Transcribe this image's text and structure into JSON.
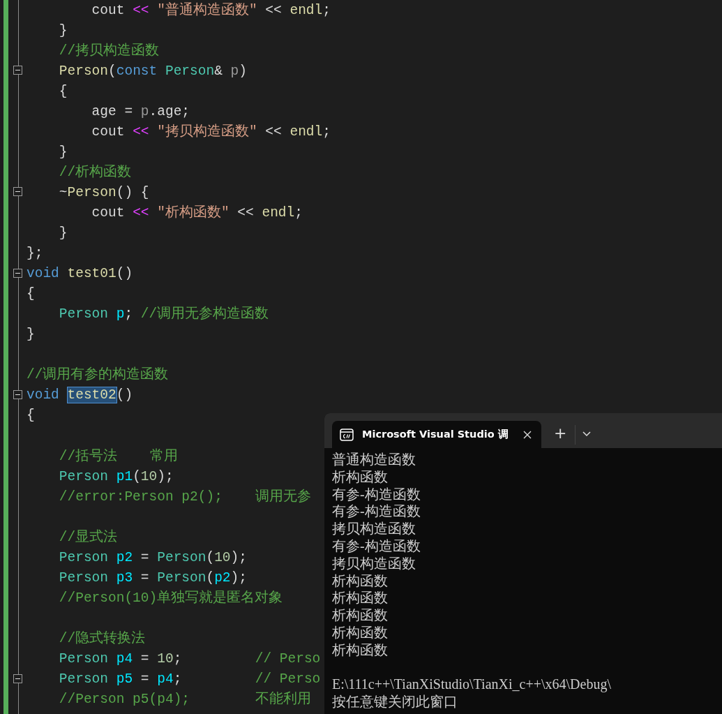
{
  "editor": {
    "lines": [
      {
        "fold": false,
        "segments": [
          {
            "text": "        cout ",
            "kind": "text"
          },
          {
            "text": "<<",
            "kind": "op"
          },
          {
            "text": " \"普通构造函数\"",
            "kind": "string"
          },
          {
            "text": " << ",
            "kind": "text"
          },
          {
            "text": "endl",
            "kind": "func"
          },
          {
            "text": ";",
            "kind": "text"
          }
        ]
      },
      {
        "fold": false,
        "segments": [
          {
            "text": "    }",
            "kind": "text"
          }
        ]
      },
      {
        "fold": false,
        "segments": [
          {
            "text": "    //拷贝构造函数",
            "kind": "comment"
          }
        ]
      },
      {
        "fold": true,
        "segments": [
          {
            "text": "    Person",
            "kind": "func"
          },
          {
            "text": "(",
            "kind": "text"
          },
          {
            "text": "const",
            "kind": "keyword"
          },
          {
            "text": " Person",
            "kind": "type"
          },
          {
            "text": "& ",
            "kind": "text"
          },
          {
            "text": "p",
            "kind": "param"
          },
          {
            "text": ")",
            "kind": "text"
          }
        ]
      },
      {
        "fold": false,
        "segments": [
          {
            "text": "    {",
            "kind": "text"
          }
        ]
      },
      {
        "fold": false,
        "segments": [
          {
            "text": "        age = ",
            "kind": "text"
          },
          {
            "text": "p",
            "kind": "param"
          },
          {
            "text": ".age;",
            "kind": "text"
          }
        ]
      },
      {
        "fold": false,
        "segments": [
          {
            "text": "        cout ",
            "kind": "text"
          },
          {
            "text": "<<",
            "kind": "op"
          },
          {
            "text": " \"拷贝构造函数\"",
            "kind": "string"
          },
          {
            "text": " << ",
            "kind": "text"
          },
          {
            "text": "endl",
            "kind": "func"
          },
          {
            "text": ";",
            "kind": "text"
          }
        ]
      },
      {
        "fold": false,
        "segments": [
          {
            "text": "    }",
            "kind": "text"
          }
        ]
      },
      {
        "fold": false,
        "segments": [
          {
            "text": "    //析构函数",
            "kind": "comment"
          }
        ]
      },
      {
        "fold": true,
        "segments": [
          {
            "text": "    ~",
            "kind": "text"
          },
          {
            "text": "Person",
            "kind": "func"
          },
          {
            "text": "() {",
            "kind": "text"
          }
        ]
      },
      {
        "fold": false,
        "segments": [
          {
            "text": "        cout ",
            "kind": "text"
          },
          {
            "text": "<<",
            "kind": "op"
          },
          {
            "text": " \"析构函数\"",
            "kind": "string"
          },
          {
            "text": " << ",
            "kind": "text"
          },
          {
            "text": "endl",
            "kind": "func"
          },
          {
            "text": ";",
            "kind": "text"
          }
        ]
      },
      {
        "fold": false,
        "segments": [
          {
            "text": "    }",
            "kind": "text"
          }
        ]
      },
      {
        "fold": false,
        "segments": [
          {
            "text": "};",
            "kind": "text"
          }
        ]
      },
      {
        "fold": true,
        "segments": [
          {
            "text": "void ",
            "kind": "keyword"
          },
          {
            "text": "test01",
            "kind": "func"
          },
          {
            "text": "()",
            "kind": "text"
          }
        ]
      },
      {
        "fold": false,
        "segments": [
          {
            "text": "{",
            "kind": "text"
          }
        ]
      },
      {
        "fold": false,
        "segments": [
          {
            "text": "    Person ",
            "kind": "type"
          },
          {
            "text": "p",
            "kind": "var"
          },
          {
            "text": "; ",
            "kind": "text"
          },
          {
            "text": "//调用无参构造函数",
            "kind": "comment"
          }
        ]
      },
      {
        "fold": false,
        "segments": [
          {
            "text": "}",
            "kind": "text"
          }
        ]
      },
      {
        "fold": false
      },
      {
        "fold": false,
        "segments": [
          {
            "text": "//调用有参的构造函数",
            "kind": "comment"
          }
        ]
      },
      {
        "fold": true,
        "segments": [
          {
            "text": "void ",
            "kind": "keyword"
          },
          {
            "text": "test02",
            "kind": "selection"
          },
          {
            "text": "()",
            "kind": "text"
          }
        ]
      },
      {
        "fold": false,
        "segments": [
          {
            "text": "{",
            "kind": "text"
          }
        ]
      },
      {
        "fold": false
      },
      {
        "fold": false,
        "segments": [
          {
            "text": "    //括号法    常用",
            "kind": "comment"
          }
        ]
      },
      {
        "fold": false,
        "segments": [
          {
            "text": "    Person ",
            "kind": "type"
          },
          {
            "text": "p1",
            "kind": "var"
          },
          {
            "text": "(",
            "kind": "text"
          },
          {
            "text": "10",
            "kind": "number"
          },
          {
            "text": ");",
            "kind": "text"
          }
        ]
      },
      {
        "fold": false,
        "segments": [
          {
            "text": "    //error:Person p2();    调用无参",
            "kind": "comment"
          }
        ]
      },
      {
        "fold": false
      },
      {
        "fold": false,
        "segments": [
          {
            "text": "    //显式法",
            "kind": "comment"
          }
        ]
      },
      {
        "fold": false,
        "segments": [
          {
            "text": "    Person ",
            "kind": "type"
          },
          {
            "text": "p2",
            "kind": "var"
          },
          {
            "text": " = ",
            "kind": "text"
          },
          {
            "text": "Person",
            "kind": "type"
          },
          {
            "text": "(",
            "kind": "text"
          },
          {
            "text": "10",
            "kind": "number"
          },
          {
            "text": ");",
            "kind": "text"
          }
        ]
      },
      {
        "fold": false,
        "segments": [
          {
            "text": "    Person ",
            "kind": "type"
          },
          {
            "text": "p3",
            "kind": "var"
          },
          {
            "text": " = ",
            "kind": "text"
          },
          {
            "text": "Person",
            "kind": "type"
          },
          {
            "text": "(",
            "kind": "text"
          },
          {
            "text": "p2",
            "kind": "var"
          },
          {
            "text": ");",
            "kind": "text"
          }
        ]
      },
      {
        "fold": false,
        "segments": [
          {
            "text": "    //Person(10)单独写就是匿名对象",
            "kind": "comment"
          }
        ]
      },
      {
        "fold": false
      },
      {
        "fold": false,
        "segments": [
          {
            "text": "    //隐式转换法",
            "kind": "comment"
          }
        ]
      },
      {
        "fold": false,
        "segments": [
          {
            "text": "    Person ",
            "kind": "type"
          },
          {
            "text": "p4",
            "kind": "var"
          },
          {
            "text": " = ",
            "kind": "text"
          },
          {
            "text": "10",
            "kind": "number"
          },
          {
            "text": ";         ",
            "kind": "text"
          },
          {
            "text": "// Perso",
            "kind": "comment"
          }
        ]
      },
      {
        "fold": true,
        "segments": [
          {
            "text": "    Person ",
            "kind": "type"
          },
          {
            "text": "p5",
            "kind": "var"
          },
          {
            "text": " = ",
            "kind": "text"
          },
          {
            "text": "p4",
            "kind": "var"
          },
          {
            "text": ";         ",
            "kind": "text"
          },
          {
            "text": "// Perso",
            "kind": "comment"
          }
        ]
      },
      {
        "fold": false,
        "segments": [
          {
            "text": "    //Person p5(p4);        不能利用",
            "kind": "comment"
          }
        ]
      }
    ]
  },
  "console_dialog": {
    "tab_title": "Microsoft Visual Studio 调",
    "new_tab": "+",
    "output": [
      "普通构造函数",
      "析构函数",
      "有参-构造函数",
      "有参-构造函数",
      "拷贝构造函数",
      "有参-构造函数",
      "拷贝构造函数",
      "析构函数",
      "析构函数",
      "析构函数",
      "析构函数",
      "析构函数"
    ],
    "path": "E:\\111c++\\TianXiStudio\\TianXi_c++\\x64\\Debug\\",
    "prompt": "按任意键关闭此窗口"
  }
}
